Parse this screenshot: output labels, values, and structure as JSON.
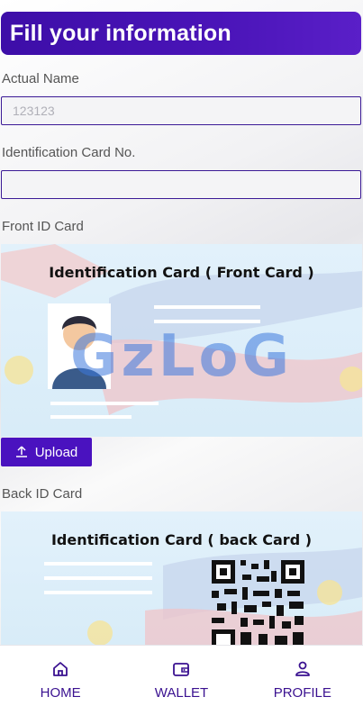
{
  "header": {
    "title": "Fill your information"
  },
  "form": {
    "actual_name_label": "Actual Name",
    "actual_name_value": "123123",
    "id_no_label": "Identification Card No.",
    "id_no_value": "",
    "front_label": "Front ID Card",
    "back_label": "Back ID Card"
  },
  "front_card": {
    "title": "Identification Card ( Front Card )",
    "watermark": "GzLoG"
  },
  "upload_button": {
    "label": "Upload",
    "icon": "upload-icon"
  },
  "back_card": {
    "title": "Identification Card ( back Card )"
  },
  "nav": {
    "items": [
      {
        "label": "HOME",
        "icon": "home-icon"
      },
      {
        "label": "WALLET",
        "icon": "wallet-icon"
      },
      {
        "label": "PROFILE",
        "icon": "profile-icon"
      }
    ]
  },
  "colors": {
    "primary": "#4a12bf",
    "header": "#3d0ea8",
    "nav_text": "#3a1190"
  }
}
